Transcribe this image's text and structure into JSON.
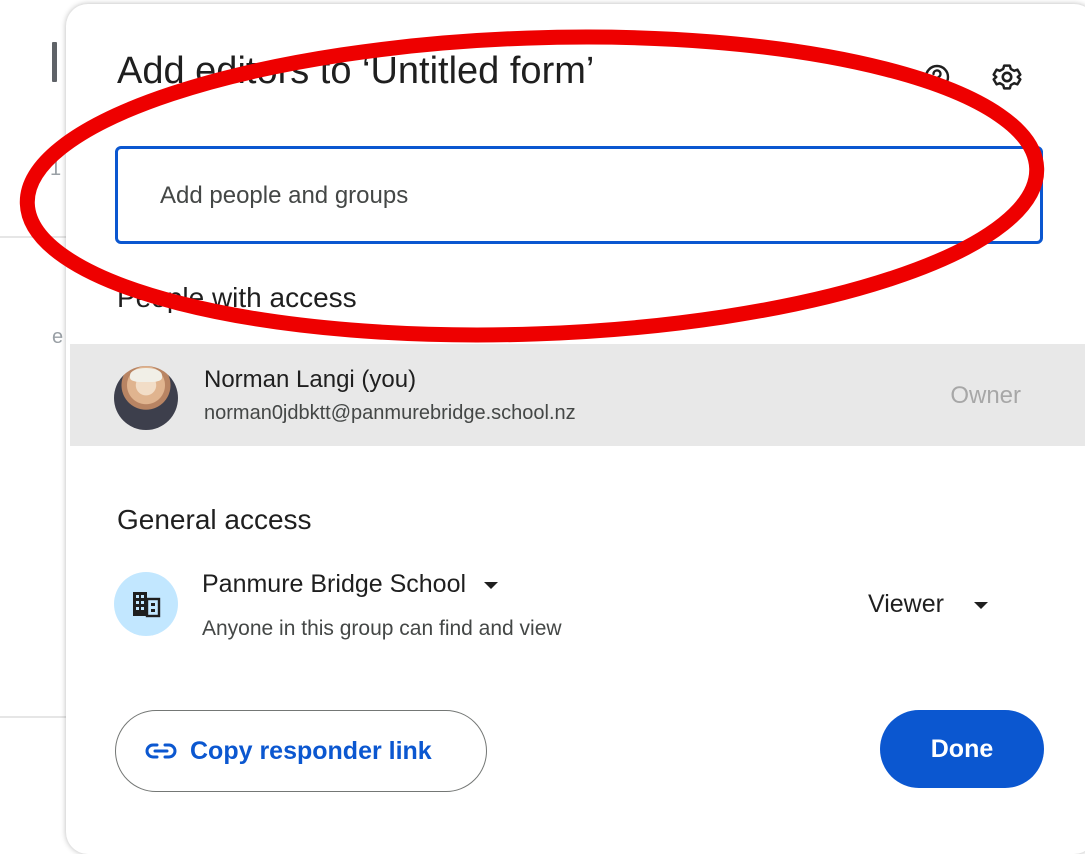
{
  "background": {
    "fragments": [
      "1",
      "e"
    ]
  },
  "dialog": {
    "title": "Add editors to ‘Untitled form’",
    "help_icon": "help-circle-icon",
    "settings_icon": "gear-icon"
  },
  "search": {
    "placeholder": "Add people and groups",
    "value": ""
  },
  "people_with_access": {
    "heading": "People with access",
    "people": [
      {
        "name": "Norman Langi (you)",
        "email": "norman0jdbktt@panmurebridge.school.nz",
        "role": "Owner",
        "avatar": "user-avatar"
      }
    ]
  },
  "general_access": {
    "heading": "General access",
    "scope": "Panmure Bridge School",
    "description": "Anyone in this group can find and view",
    "role": "Viewer",
    "icon": "building-icon"
  },
  "footer": {
    "copy_link_label": "Copy responder link",
    "copy_link_icon": "link-icon",
    "done_label": "Done"
  },
  "annotation": {
    "color": "#ee0000",
    "shape": "ellipse"
  },
  "colors": {
    "accent": "#0b57d0",
    "highlight_row": "#e8e8e8",
    "org_icon_bg": "#c2e7ff"
  }
}
